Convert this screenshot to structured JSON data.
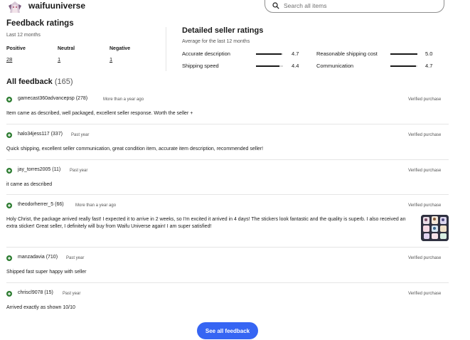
{
  "header": {
    "store_name": "waifuuniverse",
    "search_placeholder": "Search all items",
    "logo_icon": "store-logo-icon",
    "search_icon": "search-icon"
  },
  "feedback_ratings": {
    "title": "Feedback ratings",
    "period": "Last 12 months",
    "positive_label": "Positive",
    "positive_count": "28",
    "neutral_label": "Neutral",
    "neutral_count": "1",
    "negative_label": "Negative",
    "negative_count": "1"
  },
  "detailed_ratings": {
    "title": "Detailed seller ratings",
    "period": "Average for the last 12 months",
    "items": [
      {
        "label": "Accurate description",
        "value": "4.7",
        "score": 4.7
      },
      {
        "label": "Reasonable shipping cost",
        "value": "5.0",
        "score": 5.0
      },
      {
        "label": "Shipping speed",
        "value": "4.4",
        "score": 4.4
      },
      {
        "label": "Communication",
        "value": "4.7",
        "score": 4.7
      }
    ]
  },
  "all_feedback": {
    "title": "All feedback",
    "count": "(165)",
    "see_all_label": "See all feedback",
    "reviews": [
      {
        "user": "gamecast360advancepsp (278)",
        "when": "More than a year ago",
        "verified": "Verified purchase",
        "comment": "Item came as described, well packaged, excellent seller response. Worth the seller +",
        "has_image": false
      },
      {
        "user": "halo34jess117 (337)",
        "when": "Past year",
        "verified": "Verified purchase",
        "comment": "Quick shipping, excellent seller communication, great condition item, accurate item description, recommended seller!",
        "has_image": false
      },
      {
        "user": "jay_torres2005 (11)",
        "when": "Past year",
        "verified": "Verified purchase",
        "comment": "it came as described",
        "has_image": false
      },
      {
        "user": "theodorherrer_5 (66)",
        "when": "More than a year ago",
        "verified": "Verified purchase",
        "comment": "Holy Christ, the package arrived really fast! I expected it to arrive in 2 weeks, so I'm excited it arrived in 4 days! The stickers look fantastic and the quality is superb. I also received an extra sticker! Great seller, I definitely will buy from Waifu Universe again! I am super satisfied!",
        "has_image": true
      },
      {
        "user": "manzadavia (710)",
        "when": "Past year",
        "verified": "Verified purchase",
        "comment": "Shipped fast super happy with seller",
        "has_image": false
      },
      {
        "user": "chriscl9078 (15)",
        "when": "Past year",
        "verified": "Verified purchase",
        "comment": "Arrived exactly as shown 10/10",
        "has_image": false
      }
    ]
  },
  "colors": {
    "positive": "#2e7d32",
    "button": "#3665f3",
    "text": "#191919",
    "muted": "#555555"
  }
}
